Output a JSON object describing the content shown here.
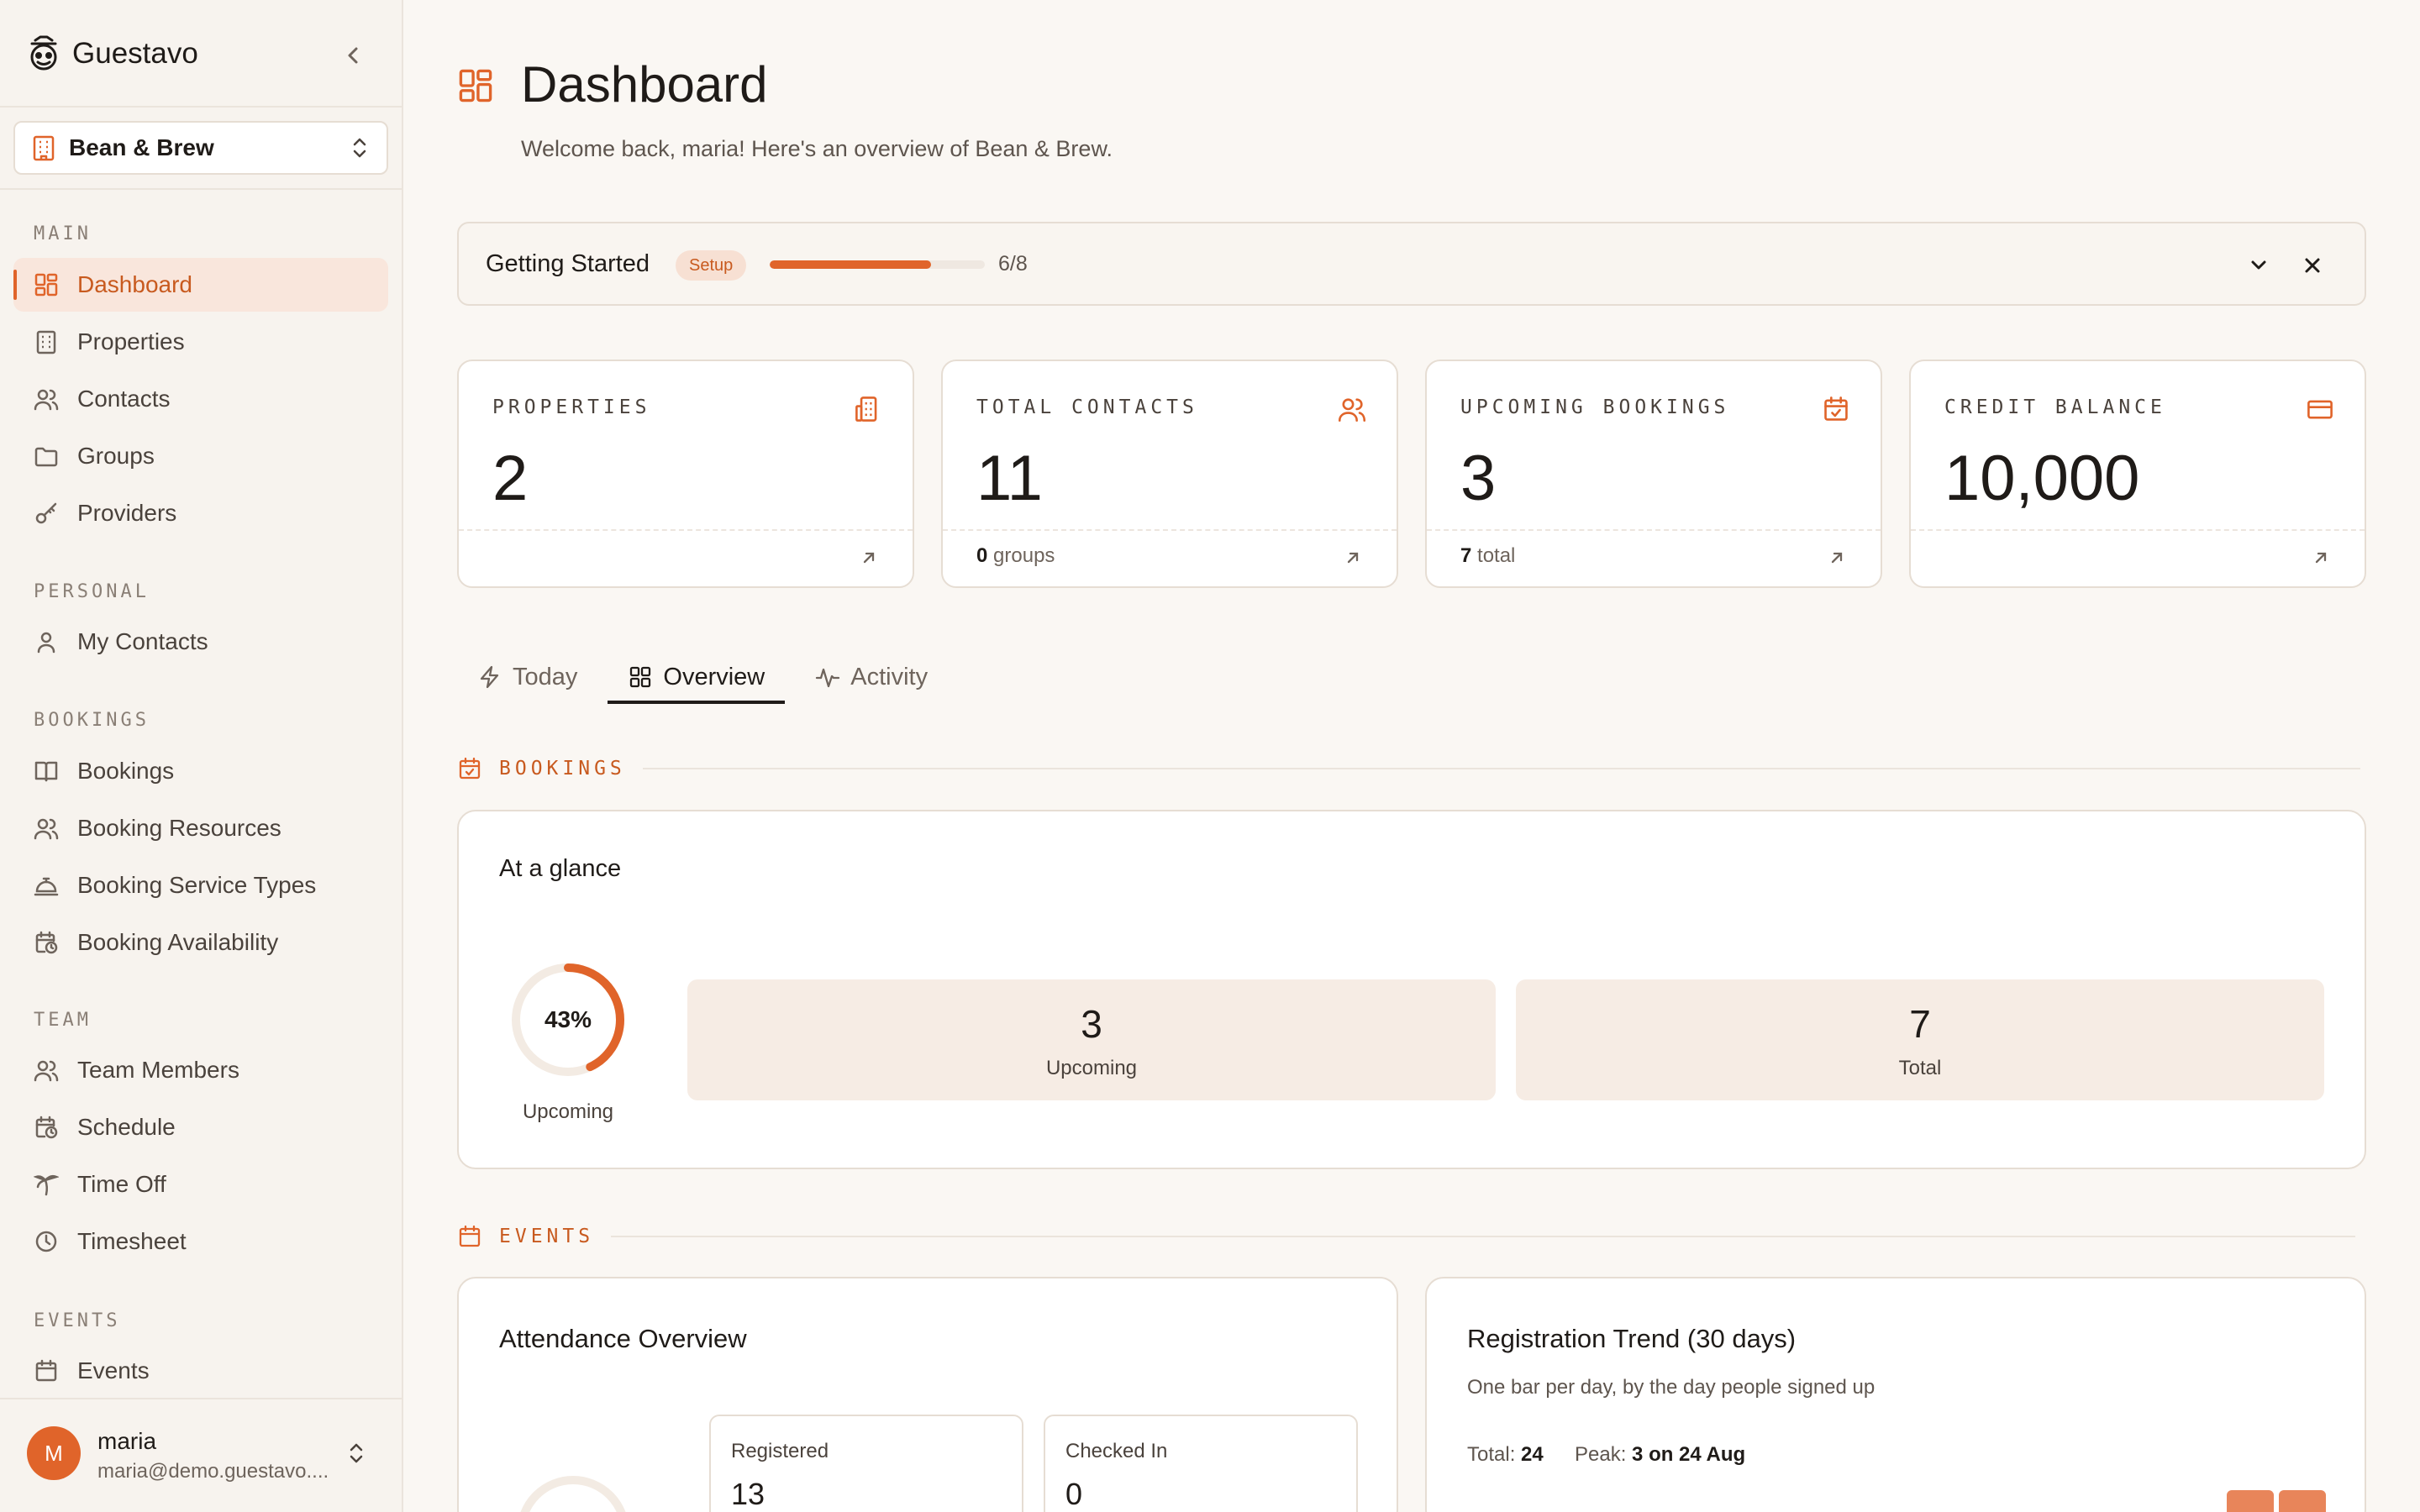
{
  "sidebar": {
    "brand": "Guestavo",
    "org": "Bean & Brew",
    "sections": [
      {
        "title": "MAIN",
        "items": [
          {
            "label": "Dashboard",
            "icon": "grid-icon"
          },
          {
            "label": "Properties",
            "icon": "building-icon"
          },
          {
            "label": "Contacts",
            "icon": "users-icon"
          },
          {
            "label": "Groups",
            "icon": "folder-icon"
          },
          {
            "label": "Providers",
            "icon": "key-icon"
          }
        ]
      },
      {
        "title": "PERSONAL",
        "items": [
          {
            "label": "My Contacts",
            "icon": "user-icon"
          }
        ]
      },
      {
        "title": "BOOKINGS",
        "items": [
          {
            "label": "Bookings",
            "icon": "book-open-icon"
          },
          {
            "label": "Booking Resources",
            "icon": "users-icon"
          },
          {
            "label": "Booking Service Types",
            "icon": "concierge-bell-icon"
          },
          {
            "label": "Booking Availability",
            "icon": "calendar-clock-icon"
          }
        ]
      },
      {
        "title": "TEAM",
        "items": [
          {
            "label": "Team Members",
            "icon": "users-icon"
          },
          {
            "label": "Schedule",
            "icon": "calendar-clock-icon"
          },
          {
            "label": "Time Off",
            "icon": "palm-tree-icon"
          },
          {
            "label": "Timesheet",
            "icon": "clock-icon"
          }
        ]
      },
      {
        "title": "EVENTS",
        "items": [
          {
            "label": "Events",
            "icon": "calendar-icon"
          }
        ]
      }
    ],
    "user": {
      "initial": "M",
      "name": "maria",
      "email": "maria@demo.guestavo...."
    }
  },
  "header": {
    "title": "Dashboard",
    "subtitle": "Welcome back, maria! Here's an overview of Bean & Brew."
  },
  "getting_started": {
    "title": "Getting Started",
    "badge": "Setup",
    "progress": 0.75,
    "count": "6/8"
  },
  "stats": [
    {
      "label": "PROPERTIES",
      "value": "2",
      "foot_num": "",
      "foot_text": "",
      "icon": "building-icon"
    },
    {
      "label": "TOTAL CONTACTS",
      "value": "11",
      "foot_num": "0",
      "foot_text": " groups",
      "icon": "users-icon"
    },
    {
      "label": "UPCOMING BOOKINGS",
      "value": "3",
      "foot_num": "7",
      "foot_text": " total",
      "icon": "calendar-check-icon"
    },
    {
      "label": "CREDIT BALANCE",
      "value": "10,000",
      "foot_num": "",
      "foot_text": "",
      "icon": "credit-card-icon"
    }
  ],
  "tabs": [
    {
      "label": "Today",
      "icon": "zap-icon"
    },
    {
      "label": "Overview",
      "icon": "grid-icon"
    },
    {
      "label": "Activity",
      "icon": "activity-icon"
    }
  ],
  "bookings_section": {
    "title": "BOOKINGS",
    "card_title": "At a glance",
    "ring_value": "43%",
    "ring_fraction": 0.43,
    "ring_label": "Upcoming",
    "tiles": [
      {
        "value": "3",
        "label": "Upcoming"
      },
      {
        "value": "7",
        "label": "Total"
      }
    ]
  },
  "events_section": {
    "title": "EVENTS",
    "attendance": {
      "title": "Attendance Overview",
      "boxes": [
        {
          "label": "Registered",
          "value": "13"
        },
        {
          "label": "Checked In",
          "value": "0"
        }
      ]
    },
    "trend": {
      "title": "Registration Trend (30 days)",
      "subtitle": "One bar per day, by the day people signed up",
      "total_label": "Total:",
      "total_value": "24",
      "peak_label": "Peak:",
      "peak_value": "3 on 24 Aug"
    }
  },
  "colors": {
    "accent": "#e0642a",
    "accent_dark": "#c85a1f",
    "tile": "#f6ece4"
  }
}
